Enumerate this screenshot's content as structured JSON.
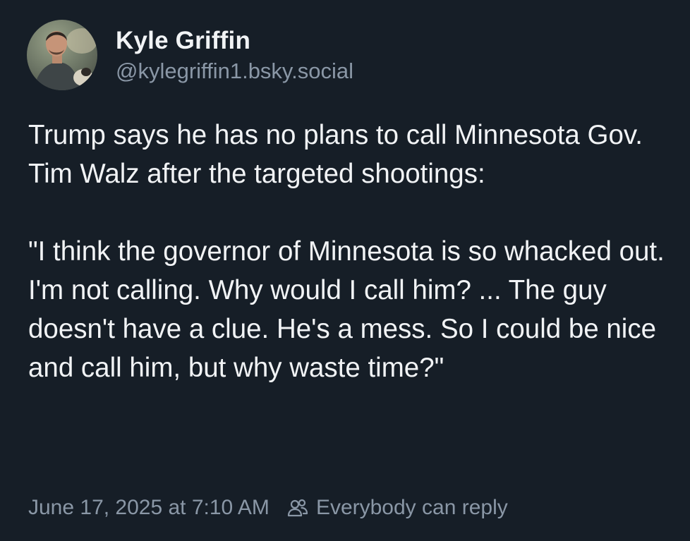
{
  "author": {
    "display_name": "Kyle Griffin",
    "handle": "@kylegriffin1.bsky.social",
    "avatar_icon": "profile-photo"
  },
  "post": {
    "paragraphs": [
      "Trump says he has no plans to call Minnesota Gov. Tim Walz after the targeted shootings:",
      "\"I think the governor of Minnesota is so whacked out. I'm not calling. Why would I call him? ... The guy doesn't have a clue. He's a mess. So I could be nice and call him, but why waste time?\""
    ]
  },
  "footer": {
    "timestamp": "June 17, 2025 at 7:10 AM",
    "reply_setting_icon": "people-icon",
    "reply_setting": "Everybody can reply"
  },
  "colors": {
    "background": "#161e27",
    "text": "#f1f3f5",
    "muted": "#8a97a6"
  }
}
